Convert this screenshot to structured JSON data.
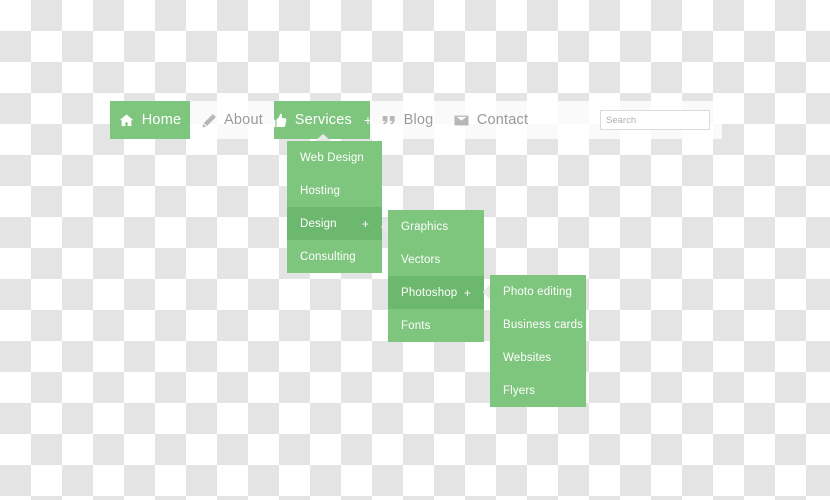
{
  "navbar": {
    "items": [
      {
        "label": "Home",
        "icon": "home-icon",
        "active": true,
        "plus": ""
      },
      {
        "label": "About",
        "icon": "magic-wand-icon",
        "active": false,
        "plus": ""
      },
      {
        "label": "Services",
        "icon": "thumbs-up-icon",
        "active": true,
        "plus": "+"
      },
      {
        "label": "Blog",
        "icon": "quote-icon",
        "active": false,
        "plus": ""
      },
      {
        "label": "Contact",
        "icon": "envelope-icon",
        "active": false,
        "plus": ""
      }
    ],
    "search": {
      "placeholder": "Search",
      "value": ""
    }
  },
  "menus": {
    "services": {
      "items": [
        {
          "label": "Web Design",
          "highlighted": false,
          "plus": ""
        },
        {
          "label": "Hosting",
          "highlighted": false,
          "plus": ""
        },
        {
          "label": "Design",
          "highlighted": true,
          "plus": "+"
        },
        {
          "label": "Consulting",
          "highlighted": false,
          "plus": ""
        }
      ]
    },
    "design": {
      "items": [
        {
          "label": "Graphics",
          "highlighted": false,
          "plus": ""
        },
        {
          "label": "Vectors",
          "highlighted": false,
          "plus": ""
        },
        {
          "label": "Photoshop",
          "highlighted": true,
          "plus": "+"
        },
        {
          "label": "Fonts",
          "highlighted": false,
          "plus": ""
        }
      ]
    },
    "photoshop": {
      "items": [
        {
          "label": "Photo editing",
          "highlighted": false,
          "plus": ""
        },
        {
          "label": "Business cards",
          "highlighted": false,
          "plus": ""
        },
        {
          "label": "Websites",
          "highlighted": false,
          "plus": ""
        },
        {
          "label": "Flyers",
          "highlighted": false,
          "plus": ""
        }
      ]
    }
  },
  "colors": {
    "accent_green": "#7ec57e",
    "accent_green_active": "#6cb86e",
    "text_grey": "#9a9a9a",
    "icon_grey": "#b7b7b7",
    "caret_grey": "#e9e9e9",
    "checker_grey": "#e4e4e4",
    "checker_white": "#ffffff"
  }
}
